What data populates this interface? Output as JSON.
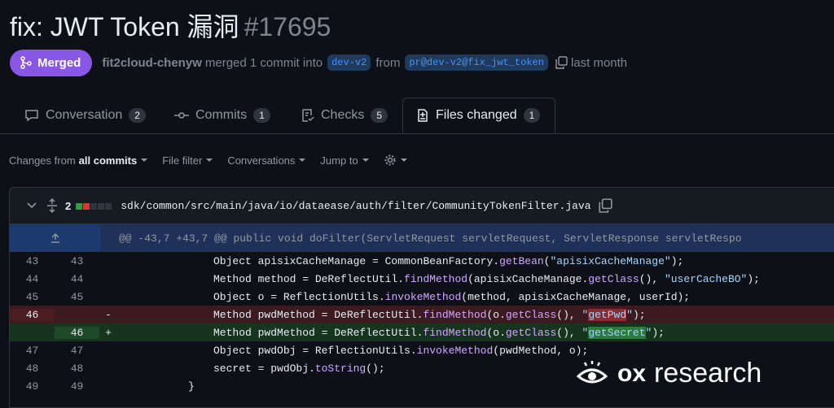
{
  "pr": {
    "title": "fix: JWT Token 漏洞",
    "number": "#17695",
    "status": "Merged",
    "author": "fit2cloud-chenyw",
    "action_text": "merged 1 commit into",
    "base_branch": "dev-v2",
    "from_text": "from",
    "head_branch": "pr@dev-v2@fix_jwt_token",
    "time": "last month"
  },
  "tabs": [
    {
      "label": "Conversation",
      "count": "2"
    },
    {
      "label": "Commits",
      "count": "1"
    },
    {
      "label": "Checks",
      "count": "5"
    },
    {
      "label": "Files changed",
      "count": "1"
    }
  ],
  "toolbar": {
    "changes_prefix": "Changes from",
    "changes_value": "all commits",
    "file_filter": "File filter",
    "conversations": "Conversations",
    "jump_to": "Jump to"
  },
  "file": {
    "changes_count": "2",
    "path": "sdk/common/src/main/java/io/dataease/auth/filter/CommunityTokenFilter.java",
    "hunk_header": "@@ -43,7 +43,7 @@ public void doFilter(ServletRequest servletRequest, ServletResponse servletRespo"
  },
  "diff": {
    "r43": {
      "old": "43",
      "new": "43",
      "a": "Object apisixCacheManage = CommonBeanFactory.",
      "f": "getBean",
      "b": "(",
      "s": "\"apisixCacheManage\"",
      "c": ");"
    },
    "r44": {
      "old": "44",
      "new": "44",
      "a": "Method method = DeReflectUtil.",
      "f1": "findMethod",
      "b": "(apisixCacheManage.",
      "f2": "getClass",
      "c": "(), ",
      "s": "\"userCacheBO\"",
      "d": ");"
    },
    "r45": {
      "old": "45",
      "new": "45",
      "a": "Object o = ReflectionUtils.",
      "f": "invokeMethod",
      "b": "(method, apisixCacheManage, userId);"
    },
    "r46del": {
      "old": "46",
      "sign": "-",
      "a": "Method pwdMethod = DeReflectUtil.",
      "f1": "findMethod",
      "b": "(o.",
      "f2": "getClass",
      "c": "(), ",
      "q1": "\"",
      "hl": "getPwd",
      "q2": "\"",
      "d": ");"
    },
    "r46add": {
      "new": "46",
      "sign": "+",
      "a": "Method pwdMethod = DeReflectUtil.",
      "f1": "findMethod",
      "b": "(o.",
      "f2": "getClass",
      "c": "(), ",
      "q1": "\"",
      "hl": "getSecret",
      "q2": "\"",
      "d": ");"
    },
    "r47": {
      "old": "47",
      "new": "47",
      "a": "Object pwdObj = ReflectionUtils.",
      "f": "invokeMethod",
      "b": "(pwdMethod, o);"
    },
    "r48": {
      "old": "48",
      "new": "48",
      "a": "secret = pwdObj.",
      "f": "toString",
      "b": "();"
    },
    "r49": {
      "old": "49",
      "new": "49",
      "a": "}"
    }
  },
  "watermark": {
    "ox": "ox",
    "text": "research"
  },
  "colors": {
    "merged": "#8957e5",
    "deleted": "#3b1b1f",
    "added": "#17341f",
    "hunk": "#1f3158"
  }
}
